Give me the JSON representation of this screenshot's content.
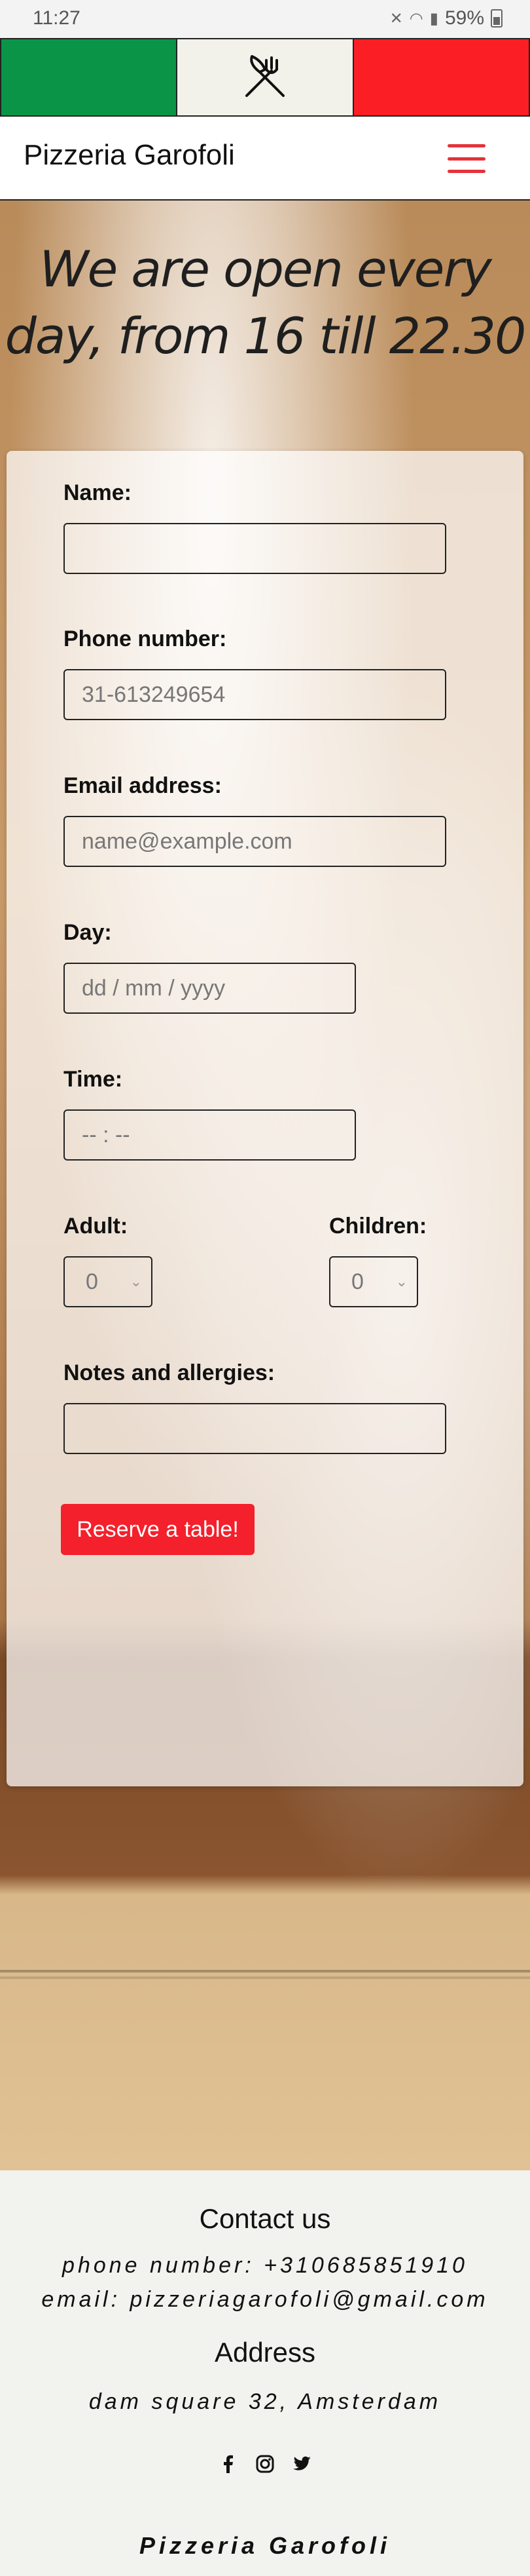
{
  "status_bar": {
    "time": "11:27",
    "battery": "59%"
  },
  "flag": {
    "colors": {
      "green": "#0a9447",
      "white": "#f2f2ea",
      "red": "#fb1f25"
    },
    "center_icon": "fork-knife-icon"
  },
  "navbar": {
    "brand": "Pizzeria Garofoli",
    "menu_icon": "hamburger-menu-icon"
  },
  "hero": {
    "title": "We are open every day, from 16 till 22.30"
  },
  "form": {
    "name_label": "Name:",
    "name_value": "",
    "phone_label": "Phone number:",
    "phone_placeholder": "31-613249654",
    "email_label": "Email address:",
    "email_placeholder": "name@example.com",
    "day_label": "Day:",
    "day_placeholder": "dd / mm / yyyy",
    "time_label": "Time:",
    "time_placeholder": "-- : --",
    "adult_label": "Adult:",
    "adult_value": "0",
    "children_label": "Children:",
    "children_value": "0",
    "notes_label": "Notes and allergies:",
    "notes_value": "",
    "submit_label": "Reserve a table!",
    "accent": "#f4202b"
  },
  "footer": {
    "contact_heading": "Contact us",
    "phone": "phone number: +310685851910",
    "email": "email: pizzeriagarofoli@gmail.com",
    "address_heading": "Address",
    "address": "dam square 32, Amsterdam",
    "socials": [
      "facebook-icon",
      "instagram-icon",
      "twitter-icon"
    ],
    "brand": "Pizzeria Garofoli"
  }
}
